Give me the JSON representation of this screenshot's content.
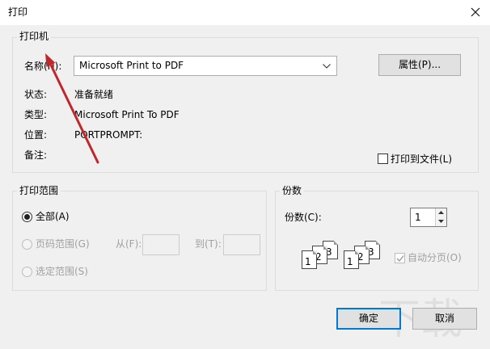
{
  "window": {
    "title": "打印"
  },
  "colors": {
    "accent": "#0078d7",
    "annotation_arrow": "#c0272d",
    "disabled_text": "#a0a0a0"
  },
  "printer": {
    "group_label": "打印机",
    "name_label": "名称(N):",
    "name_value": "Microsoft Print to PDF",
    "properties_button": "属性(P)...",
    "status_label": "状态:",
    "status_value": "准备就绪",
    "type_label": "类型:",
    "type_value": "Microsoft Print To PDF",
    "location_label": "位置:",
    "location_value": "PORTPROMPT:",
    "comment_label": "备注:",
    "print_to_file": {
      "label": "打印到文件(L)",
      "checked": false
    }
  },
  "print_range": {
    "group_label": "打印范围",
    "options": [
      {
        "label": "全部(A)",
        "checked": true,
        "disabled": false
      },
      {
        "label": "页码范围(G)",
        "checked": false,
        "disabled": true
      },
      {
        "label": "选定范围(S)",
        "checked": false,
        "disabled": true
      }
    ],
    "from_label": "从(F):",
    "from_value": "",
    "to_label": "到(T):",
    "to_value": ""
  },
  "copies": {
    "group_label": "份数",
    "count_label": "份数(C):",
    "count_value": "1",
    "collate_pages": [
      "1",
      "2",
      "3"
    ],
    "collate": {
      "label": "自动分页(O)",
      "checked": true,
      "disabled": true
    }
  },
  "buttons": {
    "ok": "确定",
    "cancel": "取消"
  },
  "watermark": "下载"
}
